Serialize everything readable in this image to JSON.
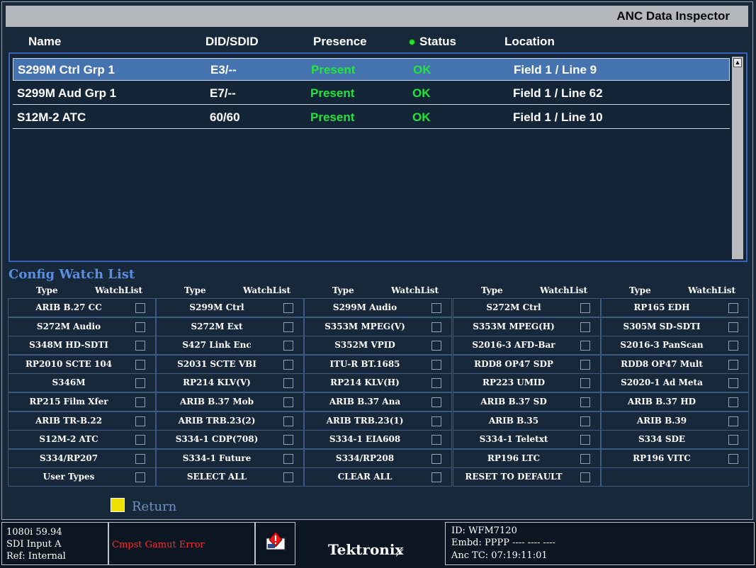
{
  "window": {
    "title": "ANC Data Inspector"
  },
  "columns": {
    "name": "Name",
    "did": "DID/SDID",
    "presence": "Presence",
    "status": "Status",
    "location": "Location"
  },
  "rows": [
    {
      "name": "S299M Ctrl Grp 1",
      "did": "E3/--",
      "presence": "Present",
      "status": "OK",
      "location": "Field 1 / Line 9",
      "selected": true
    },
    {
      "name": "S299M Aud Grp 1",
      "did": "E7/--",
      "presence": "Present",
      "status": "OK",
      "location": "Field 1 / Line 62",
      "selected": false
    },
    {
      "name": "S12M-2 ATC",
      "did": "60/60",
      "presence": "Present",
      "status": "OK",
      "location": "Field 1 / Line 10",
      "selected": false
    }
  ],
  "scrollbar": {
    "up_arrow": "▲"
  },
  "config": {
    "title": "Config Watch List",
    "type_header": "Type",
    "watch_header": "WatchList",
    "grid": [
      [
        "ARIB B.27 CC",
        "S299M Ctrl",
        "S299M Audio",
        "S272M Ctrl",
        "RP165 EDH"
      ],
      [
        "S272M Audio",
        "S272M Ext",
        "S353M MPEG(V)",
        "S353M MPEG(H)",
        "S305M SD-SDTI"
      ],
      [
        "S348M HD-SDTI",
        "S427 Link Enc",
        "S352M VPID",
        "S2016-3 AFD-Bar",
        "S2016-3 PanScan"
      ],
      [
        "RP2010 SCTE 104",
        "S2031 SCTE VBI",
        "ITU-R BT.1685",
        "RDD8 OP47 SDP",
        "RDD8 OP47 Mult"
      ],
      [
        "S346M",
        "RP214 KLV(V)",
        "RP214 KLV(H)",
        "RP223 UMID",
        "S2020-1 Ad Meta"
      ],
      [
        "RP215 Film Xfer",
        "ARIB B.37 Mob",
        "ARIB B.37 Ana",
        "ARIB B.37 SD",
        "ARIB B.37 HD"
      ],
      [
        "ARIB TR-B.22",
        "ARIB TRB.23(2)",
        "ARIB TRB.23(1)",
        "ARIB B.35",
        "ARIB B.39"
      ],
      [
        "S12M-2 ATC",
        "S334-1 CDP(708)",
        "S334-1 EIA608",
        "S334-1 Teletxt",
        "S334 SDE"
      ],
      [
        "S334/RP207",
        "S334-1 Future",
        "S334/RP208",
        "RP196 LTC",
        "RP196 VITC"
      ],
      [
        "User Types",
        "SELECT ALL",
        "CLEAR ALL",
        "RESET TO DEFAULT",
        ""
      ]
    ]
  },
  "return": {
    "label": "Return"
  },
  "status_bar": {
    "format": "1080i 59.94",
    "input": "SDI Input A",
    "ref": "Ref: Internal",
    "error": "Cmpst Gamut Error",
    "brand": "Tektronix",
    "id": "ID: WFM7120",
    "embd": "Embd: PPPP ---- ---- ----",
    "anc_tc": "Anc TC: 07:19:11:01"
  },
  "colors": {
    "accent": "#4573b0",
    "present": "#22e43a",
    "error": "#ff2a2a",
    "return_box": "#f0e000"
  },
  "icons": {
    "status_dot": "green-dot-icon",
    "alarm": "alarm-warning-icon",
    "checkbox": "checkbox-icon"
  }
}
